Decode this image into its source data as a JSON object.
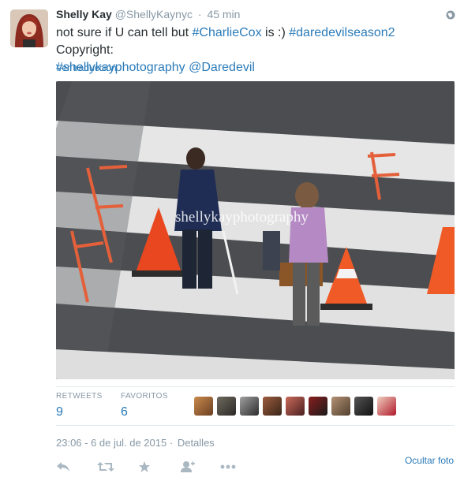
{
  "user": {
    "fullname": "Shelly Kay",
    "username": "@ShellyKaynyc",
    "time": "45 min"
  },
  "tweet": {
    "text_plain_1": "not sure if U can tell but ",
    "hashtag_1": "#CharlieCox",
    "text_plain_2": " is :) ",
    "hashtag_2": "#daredevilseason2",
    "text_plain_3": " Copyright:",
    "hashtag_3": "#shellykayphotography",
    "mention": "@Daredevil"
  },
  "translate_label": "Ver traducción",
  "photo": {
    "watermark": "shellykayphotography"
  },
  "stats": {
    "retweets_label": "RETWEETS",
    "retweets_count": "9",
    "favorites_label": "FAVORITOS",
    "favorites_count": "6"
  },
  "meta": {
    "timestamp": "23:06 - 6 de jul. de 2015",
    "separator": "·",
    "details": "Detalles"
  },
  "hide_photo_label": "Ocultar foto",
  "actions": [
    "reply-icon",
    "retweet-icon",
    "favorite-icon",
    "follow-icon",
    "more-icon"
  ],
  "colors": {
    "link": "#2b7bb9",
    "muted": "#8899a6",
    "text": "#292f33"
  }
}
